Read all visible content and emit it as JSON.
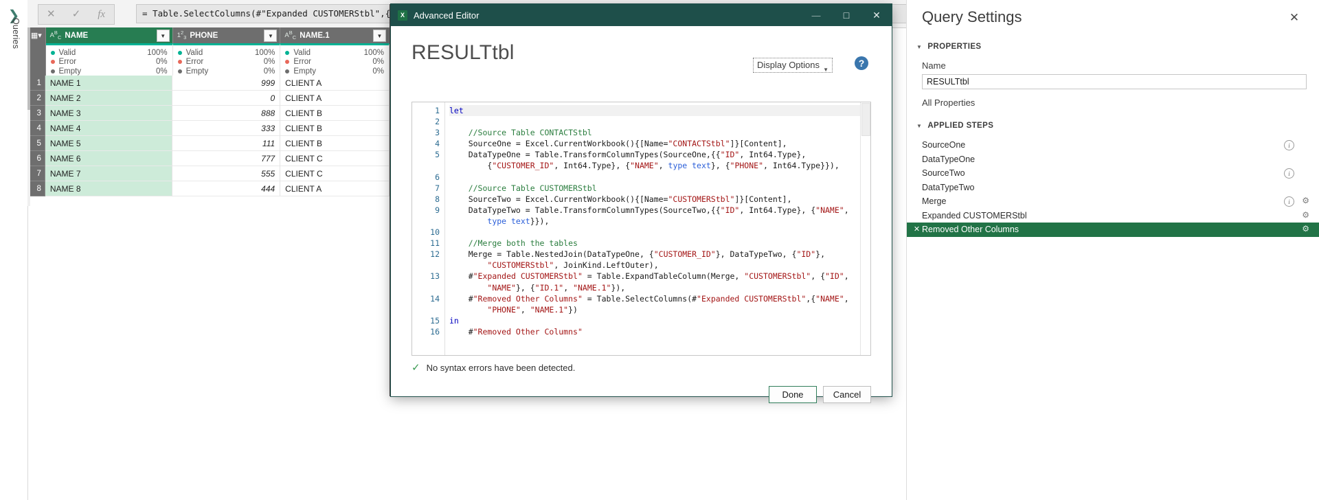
{
  "queries_pane": {
    "label": "Queries",
    "expand_icon": "chevron-right-icon"
  },
  "formula_bar": {
    "cancel_icon": "close-icon",
    "accept_icon": "check-icon",
    "fx_label": "fx",
    "formula": "= Table.SelectColumns(#\"Expanded CUSTOMERStbl\",{\"NAME\", \"PH"
  },
  "grid": {
    "corner_icon": "table-icon",
    "columns": [
      {
        "name": "NAME",
        "type_icon": "ABC",
        "selected": true,
        "dropdown_icon": "chevron-down-icon"
      },
      {
        "name": "PHONE",
        "type_icon": "123",
        "selected": false,
        "dropdown_icon": "chevron-down-icon"
      },
      {
        "name": "NAME.1",
        "type_icon": "ABC",
        "selected": false,
        "dropdown_icon": "chevron-down-icon"
      }
    ],
    "quality": [
      {
        "valid_label": "Valid",
        "valid_pct": "100%",
        "error_label": "Error",
        "error_pct": "0%",
        "empty_label": "Empty",
        "empty_pct": "0%"
      },
      {
        "valid_label": "Valid",
        "valid_pct": "100%",
        "error_label": "Error",
        "error_pct": "0%",
        "empty_label": "Empty",
        "empty_pct": "0%"
      },
      {
        "valid_label": "Valid",
        "valid_pct": "100%",
        "error_label": "Error",
        "error_pct": "0%",
        "empty_label": "Empty",
        "empty_pct": "0%"
      }
    ],
    "rows": [
      {
        "n": "1",
        "name": "NAME 1",
        "phone": "999",
        "name1": "CLIENT A"
      },
      {
        "n": "2",
        "name": "NAME 2",
        "phone": "0",
        "name1": "CLIENT A"
      },
      {
        "n": "3",
        "name": "NAME 3",
        "phone": "888",
        "name1": "CLIENT B"
      },
      {
        "n": "4",
        "name": "NAME 4",
        "phone": "333",
        "name1": "CLIENT B"
      },
      {
        "n": "5",
        "name": "NAME 5",
        "phone": "111",
        "name1": "CLIENT B"
      },
      {
        "n": "6",
        "name": "NAME 6",
        "phone": "777",
        "name1": "CLIENT C"
      },
      {
        "n": "7",
        "name": "NAME 7",
        "phone": "555",
        "name1": "CLIENT C"
      },
      {
        "n": "8",
        "name": "NAME 8",
        "phone": "444",
        "name1": "CLIENT A"
      }
    ]
  },
  "advanced_editor": {
    "window_title": "Advanced Editor",
    "app_icon": "excel-icon",
    "minimize_icon": "minimize-icon",
    "maximize_icon": "maximize-icon",
    "close_icon": "close-icon",
    "query_name": "RESULTtbl",
    "display_options_label": "Display Options",
    "display_options_caret": "chevron-down-icon",
    "help_icon": "help-icon",
    "help_glyph": "?",
    "syntax_status": "No syntax errors have been detected.",
    "syntax_check_icon": "check-icon",
    "done_label": "Done",
    "cancel_label": "Cancel",
    "line_numbers": [
      "1",
      "2",
      "3",
      "4",
      "5",
      "",
      "6",
      "7",
      "8",
      "9",
      "",
      "10",
      "11",
      "12",
      "",
      "13",
      "",
      "14",
      "",
      "15",
      "16"
    ],
    "code_lines": [
      {
        "num": "1",
        "html": "<span class=\"kw\">let</span>"
      },
      {
        "num": "2",
        "html": ""
      },
      {
        "num": "3",
        "html": "    <span class=\"cm\">//Source Table CONTACTStbl</span>"
      },
      {
        "num": "4",
        "html": "    SourceOne = Excel.CurrentWorkbook(){[Name=<span class=\"st\">\"CONTACTStbl\"</span>]}[Content],"
      },
      {
        "num": "5",
        "html": "    DataTypeOne = Table.TransformColumnTypes(SourceOne,{{<span class=\"st\">\"ID\"</span>, Int64.Type},"
      },
      {
        "num": "",
        "html": "        {<span class=\"st\">\"CUSTOMER_ID\"</span>, Int64.Type}, {<span class=\"st\">\"NAME\"</span>, <span class=\"ty\">type text</span>}, {<span class=\"st\">\"PHONE\"</span>, Int64.Type}}),"
      },
      {
        "num": "6",
        "html": ""
      },
      {
        "num": "7",
        "html": "    <span class=\"cm\">//Source Table CUSTOMERStbl</span>"
      },
      {
        "num": "8",
        "html": "    SourceTwo = Excel.CurrentWorkbook(){[Name=<span class=\"st\">\"CUSTOMERStbl\"</span>]}[Content],"
      },
      {
        "num": "9",
        "html": "    DataTypeTwo = Table.TransformColumnTypes(SourceTwo,{{<span class=\"st\">\"ID\"</span>, Int64.Type}, {<span class=\"st\">\"NAME\"</span>,"
      },
      {
        "num": "",
        "html": "        <span class=\"ty\">type text</span>}}),"
      },
      {
        "num": "10",
        "html": ""
      },
      {
        "num": "11",
        "html": "    <span class=\"cm\">//Merge both the tables</span>"
      },
      {
        "num": "12",
        "html": "    Merge = Table.NestedJoin(DataTypeOne, {<span class=\"st\">\"CUSTOMER_ID\"</span>}, DataTypeTwo, {<span class=\"st\">\"ID\"</span>},"
      },
      {
        "num": "",
        "html": "        <span class=\"st\">\"CUSTOMERStbl\"</span>, JoinKind.LeftOuter),"
      },
      {
        "num": "13",
        "html": "    #<span class=\"st\">\"Expanded CUSTOMERStbl\"</span> = Table.ExpandTableColumn(Merge, <span class=\"st\">\"CUSTOMERStbl\"</span>, {<span class=\"st\">\"ID\"</span>,"
      },
      {
        "num": "",
        "html": "        <span class=\"st\">\"NAME\"</span>}, {<span class=\"st\">\"ID.1\"</span>, <span class=\"st\">\"NAME.1\"</span>}),"
      },
      {
        "num": "14",
        "html": "    #<span class=\"st\">\"Removed Other Columns\"</span> = Table.SelectColumns(#<span class=\"st\">\"Expanded CUSTOMERStbl\"</span>,{<span class=\"st\">\"NAME\"</span>,"
      },
      {
        "num": "",
        "html": "        <span class=\"st\">\"PHONE\"</span>, <span class=\"st\">\"NAME.1\"</span>})"
      },
      {
        "num": "15",
        "html": "<span class=\"kw\">in</span>"
      },
      {
        "num": "16",
        "html": "    #<span class=\"st\">\"Removed Other Columns\"</span>"
      }
    ]
  },
  "query_settings": {
    "title": "Query Settings",
    "close_icon": "close-icon",
    "properties_header": "PROPERTIES",
    "name_label": "Name",
    "name_value": "RESULTtbl",
    "all_properties_label": "All Properties",
    "applied_steps_header": "APPLIED STEPS",
    "steps": [
      {
        "label": "SourceOne",
        "active": false,
        "info": true,
        "gear": false
      },
      {
        "label": "DataTypeOne",
        "active": false,
        "info": false,
        "gear": false
      },
      {
        "label": "SourceTwo",
        "active": false,
        "info": true,
        "gear": false
      },
      {
        "label": "DataTypeTwo",
        "active": false,
        "info": false,
        "gear": false
      },
      {
        "label": "Merge",
        "active": false,
        "info": true,
        "gear": true
      },
      {
        "label": "Expanded CUSTOMERStbl",
        "active": false,
        "info": false,
        "gear": true
      },
      {
        "label": "Removed Other Columns",
        "active": true,
        "info": false,
        "gear": true
      }
    ],
    "info_glyph": "i",
    "gear_glyph": "⚙",
    "delete_glyph": "✕",
    "accent_color": "#217346"
  }
}
